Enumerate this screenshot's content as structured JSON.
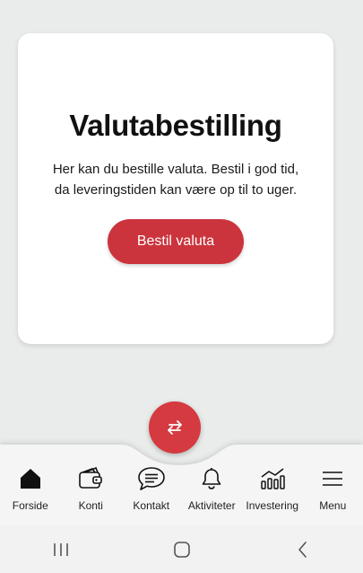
{
  "card": {
    "title": "Valutabestilling",
    "text": "Her kan du bestille valuta. Bestil i god tid, da leveringstiden kan være op til to uger.",
    "button_label": "Bestil valuta"
  },
  "fab": {
    "icon": "swap-arrows-icon"
  },
  "tabs": [
    {
      "label": "Forside",
      "icon": "home-icon"
    },
    {
      "label": "Konti",
      "icon": "wallet-icon"
    },
    {
      "label": "Kontakt",
      "icon": "chat-icon"
    },
    {
      "label": "Aktiviteter",
      "icon": "bell-icon"
    },
    {
      "label": "Investering",
      "icon": "chart-icon"
    },
    {
      "label": "Menu",
      "icon": "menu-icon"
    }
  ],
  "system_nav": [
    {
      "icon": "recent-apps-icon"
    },
    {
      "icon": "home-circle-icon"
    },
    {
      "icon": "back-icon"
    }
  ],
  "colors": {
    "accent": "#cc343d",
    "background": "#e9ecea",
    "card": "#ffffff"
  }
}
